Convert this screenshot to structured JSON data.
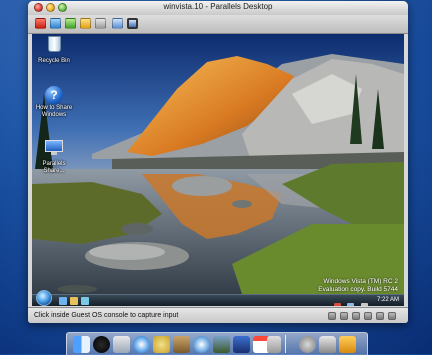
{
  "window": {
    "title": "winvista.10 - Parallels Desktop",
    "status_text": "Click inside Guest OS console to capture input"
  },
  "toolbar": {
    "buttons": [
      "stop",
      "suspend",
      "play",
      "reset",
      "screenshot",
      "window-mode",
      "full-screen"
    ]
  },
  "guest": {
    "desktop_icons": [
      {
        "label": "Recycle Bin",
        "icon": "recycle-bin-icon"
      },
      {
        "label": "How to Share Windows",
        "icon": "help-icon"
      },
      {
        "label": "Parallels Share...",
        "icon": "shared-folder-icon"
      }
    ],
    "watermark_line1": "Windows Vista (TM) RC 2",
    "watermark_line2": "Evaluation copy. Build 5744",
    "clock": "7:22 AM"
  },
  "dock": {
    "apps": [
      "finder-icon",
      "dashboard-icon",
      "mail-icon",
      "safari-icon",
      "ichat-icon",
      "address-book-icon",
      "itunes-icon",
      "iphoto-icon",
      "imovie-icon",
      "ical-icon",
      "preview-icon",
      "system-preferences-icon",
      "parallels-icon",
      "trash-icon"
    ]
  }
}
